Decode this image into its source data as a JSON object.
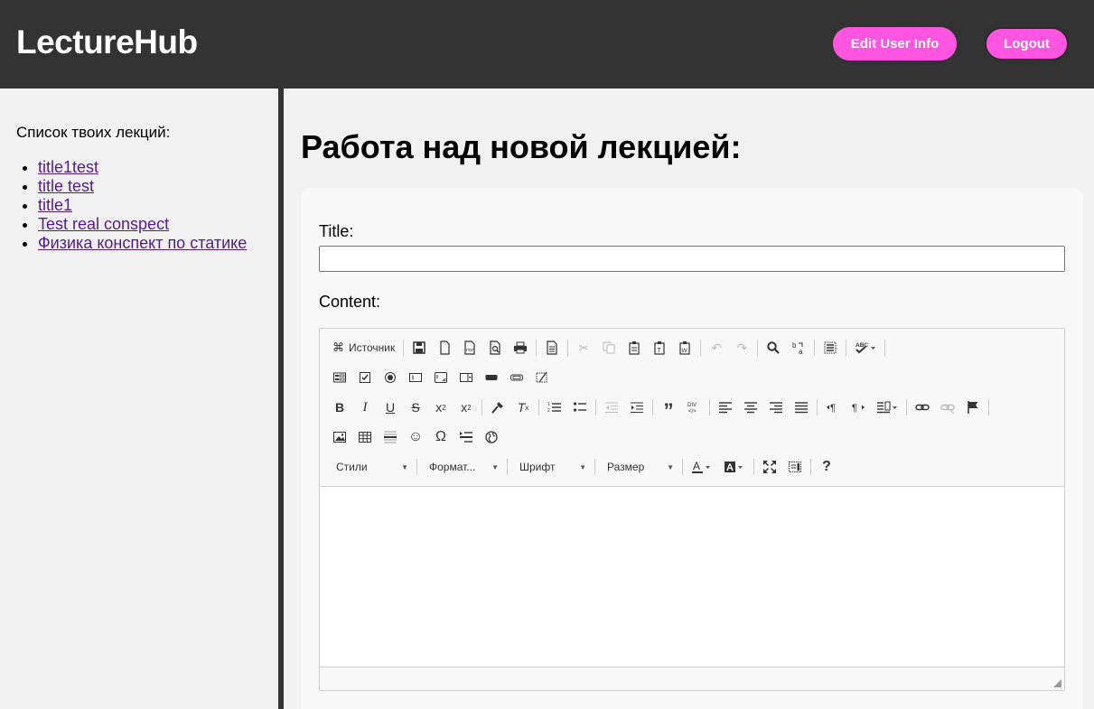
{
  "header": {
    "logo": "LectureHub",
    "edit_user_label": "Edit User Info",
    "logout_label": "Logout"
  },
  "sidebar": {
    "heading": "Список твоих лекций:",
    "lectures": [
      "title1test",
      "title test",
      "title1",
      "Test real conspect",
      "Физика конспект по статике"
    ]
  },
  "main": {
    "title": "Работа над новой лекцией:",
    "title_label": "Title:",
    "title_value": "",
    "content_label": "Content:"
  },
  "editor": {
    "source_label": "Источник",
    "combo_styles": "Стили",
    "combo_format": "Формат...",
    "combo_font": "Шрифт",
    "combo_size": "Размер",
    "help_label": "?"
  },
  "colors": {
    "header_bg": "#333333",
    "accent": "#ff55e0",
    "link": "#551a8b"
  }
}
